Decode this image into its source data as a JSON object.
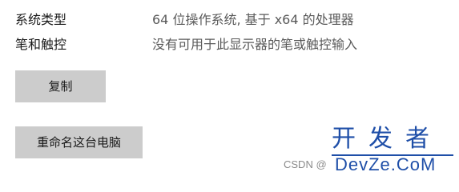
{
  "system_info": {
    "rows": [
      {
        "label": "系统类型",
        "value": "64 位操作系统, 基于 x64 的处理器"
      },
      {
        "label": "笔和触控",
        "value": "没有可用于此显示器的笔或触控输入"
      }
    ]
  },
  "actions": {
    "copy_label": "复制",
    "rename_label": "重命名这台电脑"
  },
  "watermark": {
    "csdn_text": "CSDN @",
    "logo_cn": "开发者",
    "logo_en": "DevZe.CoM"
  },
  "colors": {
    "button_bg": "#cccccc",
    "label_text": "#1a1a1a",
    "value_text": "#5a5a5a",
    "logo_blue": "#1f4fa8"
  }
}
